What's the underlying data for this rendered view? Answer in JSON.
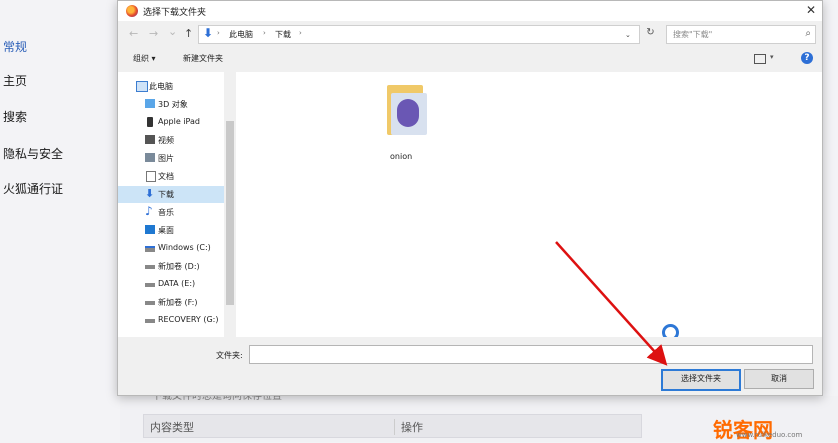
{
  "background": {
    "nav": [
      "常规",
      "主页",
      "搜索",
      "隐私与安全",
      "火狐通行证"
    ],
    "partial_text": "下载文件时总是询问保存位置",
    "table_headers": [
      "内容类型",
      "操作"
    ]
  },
  "dialog": {
    "title": "选择下载文件夹",
    "close": "✕",
    "nav_buttons": [
      "←",
      "→",
      "⌄",
      "↑"
    ],
    "breadcrumb": [
      "此电脑",
      "下载"
    ],
    "search_placeholder": "搜索\"下载\"",
    "toolbar": {
      "organize": "组织 ▾",
      "new_folder": "新建文件夹"
    },
    "sidebar": [
      {
        "label": "此电脑",
        "icon": "computer-icon",
        "root": true
      },
      {
        "label": "3D 对象",
        "icon": "cube-icon"
      },
      {
        "label": "Apple iPad",
        "icon": "ipad-icon"
      },
      {
        "label": "视频",
        "icon": "video-icon"
      },
      {
        "label": "图片",
        "icon": "picture-icon"
      },
      {
        "label": "文档",
        "icon": "document-icon"
      },
      {
        "label": "下载",
        "icon": "download-icon",
        "selected": true
      },
      {
        "label": "音乐",
        "icon": "music-icon"
      },
      {
        "label": "桌面",
        "icon": "desktop-icon"
      },
      {
        "label": "Windows (C:)",
        "icon": "windows-drive-icon"
      },
      {
        "label": "新加卷 (D:)",
        "icon": "drive-icon"
      },
      {
        "label": "DATA (E:)",
        "icon": "drive-icon"
      },
      {
        "label": "新加卷 (F:)",
        "icon": "drive-icon"
      },
      {
        "label": "RECOVERY (G:)",
        "icon": "drive-icon"
      }
    ],
    "files": [
      {
        "name": "onion",
        "icon": "folder-icon"
      }
    ],
    "footer": {
      "folder_label": "文件夹:",
      "folder_value": "",
      "select_button": "选择文件夹",
      "cancel_button": "取消"
    }
  },
  "watermark": {
    "text": "锐客网",
    "url": "www.ruikeduo.com"
  }
}
